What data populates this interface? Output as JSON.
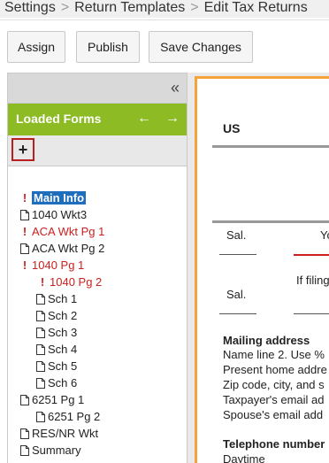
{
  "breadcrumb": {
    "items": [
      "Settings",
      "Return Templates",
      "Edit Tax Returns"
    ],
    "separator": ">"
  },
  "toolbar": {
    "assign_label": "Assign",
    "publish_label": "Publish",
    "save_label": "Save Changes"
  },
  "sidebar": {
    "collapse_icon": "«",
    "title": "Loaded Forms",
    "prev_icon": "←",
    "next_icon": "→",
    "add_icon": "+",
    "items": [
      {
        "label": "Main Info",
        "icon": "alert",
        "status": "selected"
      },
      {
        "label": "1040 Wkt3",
        "icon": "file"
      },
      {
        "label": "ACA Wkt Pg 1",
        "icon": "alert",
        "status": "error"
      },
      {
        "label": "ACA Wkt Pg 2",
        "icon": "file"
      },
      {
        "label": "1040 Pg 1",
        "icon": "alert",
        "status": "error"
      },
      {
        "label": "1040 Pg 2",
        "icon": "alert",
        "status": "error"
      },
      {
        "label": "Sch 1",
        "icon": "file"
      },
      {
        "label": "Sch 2",
        "icon": "file"
      },
      {
        "label": "Sch 3",
        "icon": "file"
      },
      {
        "label": "Sch 4",
        "icon": "file"
      },
      {
        "label": "Sch 5",
        "icon": "file"
      },
      {
        "label": "Sch 6",
        "icon": "file"
      },
      {
        "label": "6251 Pg 1",
        "icon": "file"
      },
      {
        "label": "6251 Pg 2",
        "icon": "file"
      },
      {
        "label": "RES/NR Wkt",
        "icon": "file"
      },
      {
        "label": "Summary",
        "icon": "file"
      }
    ]
  },
  "preview": {
    "us_label": "US",
    "sal_label_1": "Sal.",
    "yo_label": "Yo",
    "if_filing_label": "If filing",
    "sal_label_2": "Sal.",
    "mailing_heading": "Mailing address",
    "mailing_lines": [
      "Name line 2. Use %",
      "Present home addre",
      "Zip code, city, and s",
      "Taxpayer's email ad",
      "Spouse's email add"
    ],
    "telephone_heading": "Telephone number",
    "daytime_label": "Daytime"
  },
  "colors": {
    "accent_green": "#8cbb23",
    "selection_blue": "#1f6dbd",
    "alert_red": "#cc1f1f",
    "page_border_orange": "#f4a23a"
  }
}
